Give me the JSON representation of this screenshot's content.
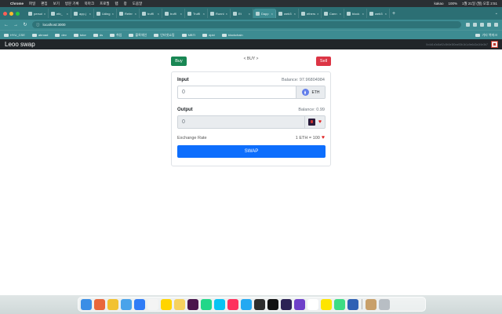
{
  "menubar": {
    "app": "Chrome",
    "items": [
      "파일",
      "편집",
      "보기",
      "방문 기록",
      "북마크",
      "프로필",
      "탭",
      "창",
      "도움말"
    ],
    "right": [
      "100%",
      "kakao",
      "1월 21일 (월) 오후 2:51"
    ]
  },
  "browser": {
    "tabs": [
      {
        "label": "persoi",
        "icon": "tab-favicon"
      },
      {
        "label": "etb_",
        "icon": "github-icon"
      },
      {
        "label": "app.j",
        "icon": "github-icon"
      },
      {
        "label": "Uding",
        "icon": "tab-favicon"
      },
      {
        "label": "Refer",
        "icon": "tab-favicon"
      },
      {
        "label": "truffl",
        "icon": "tab-favicon"
      },
      {
        "label": "truffl",
        "icon": "github-icon"
      },
      {
        "label": "Truffl",
        "icon": "tab-favicon"
      },
      {
        "label": "Runni",
        "icon": "tab-favicon"
      },
      {
        "label": "Et",
        "icon": "tab-favicon"
      },
      {
        "label": "Dapp",
        "icon": "tab-favicon",
        "active": true
      },
      {
        "label": "web3",
        "icon": "tab-favicon"
      },
      {
        "label": "ethers",
        "icon": "tab-favicon"
      },
      {
        "label": "Cann",
        "icon": "github-icon"
      },
      {
        "label": "block",
        "icon": "tab-favicon"
      },
      {
        "label": "web3",
        "icon": "tab-favicon"
      }
    ],
    "url": "localhost:3000",
    "bookmarks": [
      "HYU_CSE",
      "abroad",
      "dev",
      "tutor",
      "ds",
      "취업",
      "블록체인",
      "인터넷쇼핑",
      "MBTI",
      "dpld",
      "blockchain"
    ],
    "other_bookmarks": "기타 북마크"
  },
  "app": {
    "brand": "Leoo swap",
    "account": "0x4d1c0c8a92c5b0e3f0ea93b1b1c9e6d2a1f4e3b7"
  },
  "swap": {
    "buy_label": "Buy",
    "sell_label": "Sell",
    "mode_label": "< BUY >",
    "input": {
      "label": "Input",
      "balance": "Balance: 97.96804984",
      "value": "0",
      "token": "ETH",
      "token_icon": "eth-icon"
    },
    "output": {
      "label": "Output",
      "balance": "Balance: 0.99",
      "value": "0",
      "token_icon": "token-icon",
      "token_symbol": "♥"
    },
    "rate_label": "Exchange Rate",
    "rate_value": "1 ETH = 100",
    "rate_symbol": "♥",
    "swap_label": "SWAP"
  },
  "colors": {
    "buy": "#198754",
    "sell": "#dc3545",
    "swap": "#0d6efd",
    "chrome_theme": "#2c6f74",
    "navbar": "#212529"
  },
  "dock": {
    "apps": [
      {
        "name": "finder-icon",
        "color": "#3a8ee6"
      },
      {
        "name": "launchpad-icon",
        "color": "#e8673c"
      },
      {
        "name": "chrome-icon",
        "color": "#f2c230"
      },
      {
        "name": "safari-icon",
        "color": "#4aa3ea"
      },
      {
        "name": "app-store-icon",
        "color": "#2f7cf6"
      },
      {
        "name": "calendar-icon",
        "color": "#f4f4f4"
      },
      {
        "name": "kakaotalk-icon",
        "color": "#ffd400"
      },
      {
        "name": "notes-icon",
        "color": "#f6d25e"
      },
      {
        "name": "slack-icon",
        "color": "#4a154b"
      },
      {
        "name": "pycharm-icon",
        "color": "#21d789"
      },
      {
        "name": "webstorm-icon",
        "color": "#07c3f2"
      },
      {
        "name": "intellij-icon",
        "color": "#fe315d"
      },
      {
        "name": "vscode-icon",
        "color": "#23a9f2"
      },
      {
        "name": "xcode-icon",
        "color": "#2d2d2d"
      },
      {
        "name": "terminal-icon",
        "color": "#111111"
      },
      {
        "name": "eclipse-icon",
        "color": "#2c2255"
      },
      {
        "name": "github-desktop-icon",
        "color": "#6e40c9"
      },
      {
        "name": "notion-icon",
        "color": "#ffffff"
      },
      {
        "name": "kakao-icon",
        "color": "#fee500"
      },
      {
        "name": "android-studio-icon",
        "color": "#3ddc84"
      },
      {
        "name": "virtualbox-icon",
        "color": "#2f61b4"
      },
      {
        "name": "archive-icon",
        "color": "#c8a06a"
      },
      {
        "name": "trash-icon",
        "color": "#b8bec4"
      }
    ]
  }
}
